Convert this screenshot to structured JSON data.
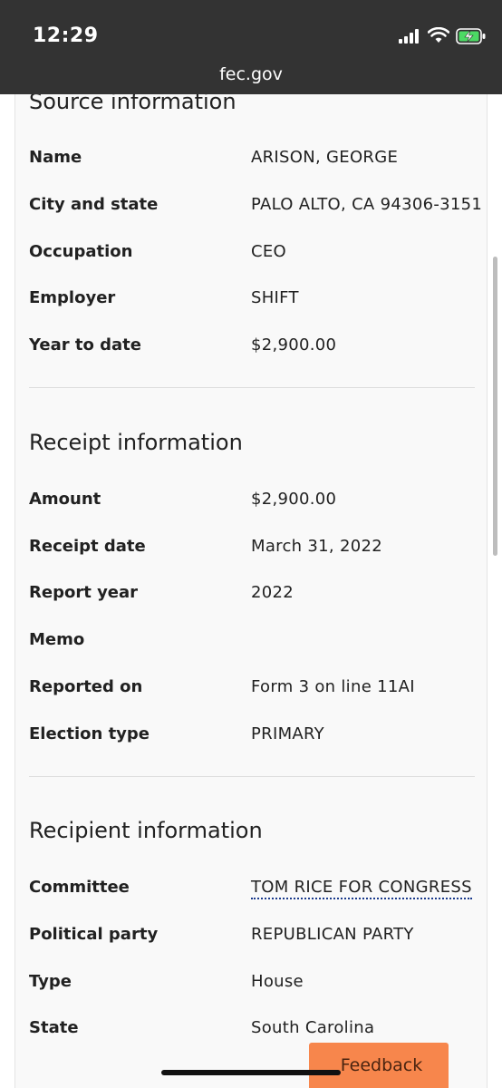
{
  "status_bar": {
    "time": "12:29",
    "url": "fec.gov"
  },
  "source": {
    "title": "Source information",
    "rows": [
      {
        "label": "Name",
        "value": "ARISON, GEORGE"
      },
      {
        "label": "City and state",
        "value": "PALO ALTO, CA 94306-3151"
      },
      {
        "label": "Occupation",
        "value": "CEO"
      },
      {
        "label": "Employer",
        "value": "SHIFT"
      },
      {
        "label": "Year to date",
        "value": "$2,900.00"
      }
    ]
  },
  "receipt": {
    "title": "Receipt information",
    "rows": [
      {
        "label": "Amount",
        "value": "$2,900.00"
      },
      {
        "label": "Receipt date",
        "value": "March 31, 2022"
      },
      {
        "label": "Report year",
        "value": "2022"
      },
      {
        "label": "Memo",
        "value": ""
      },
      {
        "label": "Reported on",
        "value": "Form 3 on line 11AI"
      },
      {
        "label": "Election type",
        "value": "PRIMARY"
      }
    ]
  },
  "recipient": {
    "title": "Recipient information",
    "rows": [
      {
        "label": "Committee",
        "value": "TOM RICE FOR CONGRESS"
      },
      {
        "label": "Political party",
        "value": "REPUBLICAN PARTY"
      },
      {
        "label": "Type",
        "value": "House"
      },
      {
        "label": "State",
        "value": "South Carolina"
      }
    ]
  },
  "feedback_label": "Feedback",
  "colors": {
    "status_bar_bg": "#333333",
    "feedback_bg": "#f7864c",
    "link_underline": "#1a3a8c",
    "battery_green": "#4cd964"
  }
}
